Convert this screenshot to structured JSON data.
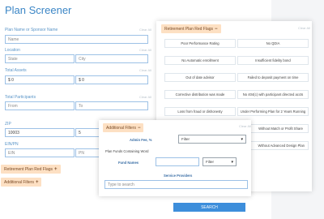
{
  "page": {
    "title": "Plan Screener"
  },
  "form": {
    "clear_label": "Clear All",
    "plan_name": {
      "label": "Plan Name or Sponsor Name",
      "placeholder": "Name"
    },
    "location": {
      "label": "Location",
      "state_placeholder": "State",
      "city_placeholder": "City"
    },
    "total_assets": {
      "label": "Total Assets",
      "min": "$ 0",
      "max": "$ 0"
    },
    "participants": {
      "label": "Total Participants",
      "from_placeholder": "From",
      "to_placeholder": "To"
    },
    "zip": {
      "label": "ZIP",
      "zip": "10003",
      "radius": "5"
    },
    "ein": {
      "label": "EIN/PN",
      "ein_placeholder": "EIN",
      "pn_placeholder": "PN"
    }
  },
  "buttons": {
    "red_flags": "Retirement Plan Red Flags",
    "additional": "Additional Filters",
    "search": "SEARCH"
  },
  "red_flags_panel": {
    "header": "Retirement Plan Red Flags",
    "clear_label": "Clear All",
    "flags": [
      "Poor Performance Rating",
      "No QDIA",
      "No Automatic enrollment",
      "Insufficient fidelity bond",
      "Out of date advisor",
      "Failed to deposit payment on time",
      "Corrective distribution was made",
      "No 404(c) with participant directed accts",
      "Loss from fraud or dishonesty",
      "Under Performing Plan for 2 Years Running",
      "",
      "Without Match or Profit Share",
      "",
      "Without Advanced Design Plan"
    ]
  },
  "additional_panel": {
    "header": "Additional Filters",
    "clear_label": "Clear All",
    "admin_fee_label": "Admin Fee, %",
    "admin_fee_select": "Filter",
    "plan_funds_text": "Plan Funds Containing Word",
    "fund_names_label": "Fund Names",
    "fund_names_select": "Filter",
    "service_provider_label": "Service Providers",
    "search_placeholder": "Type to search"
  }
}
